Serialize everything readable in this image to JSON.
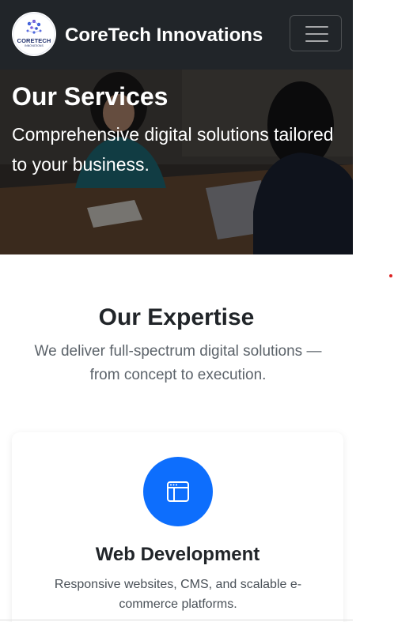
{
  "navbar": {
    "brand": "CoreTech Innovations",
    "logo_text": "CORETECH",
    "logo_subtext": "INNOVATIONS",
    "toggler_icon": "hamburger-menu-icon"
  },
  "hero": {
    "title": "Our Services",
    "subtitle": "Comprehensive digital solutions tailored to your business."
  },
  "expertise": {
    "title": "Our Expertise",
    "subtitle": "We deliver full-spectrum digital solutions — from concept to execution."
  },
  "cards": [
    {
      "icon": "browser-window-icon",
      "title": "Web Development",
      "text": "Responsive websites, CMS, and scalable e-commerce platforms."
    }
  ],
  "colors": {
    "navbar_bg": "#212529",
    "accent": "#0d6efd",
    "muted_text": "#5c636a"
  }
}
